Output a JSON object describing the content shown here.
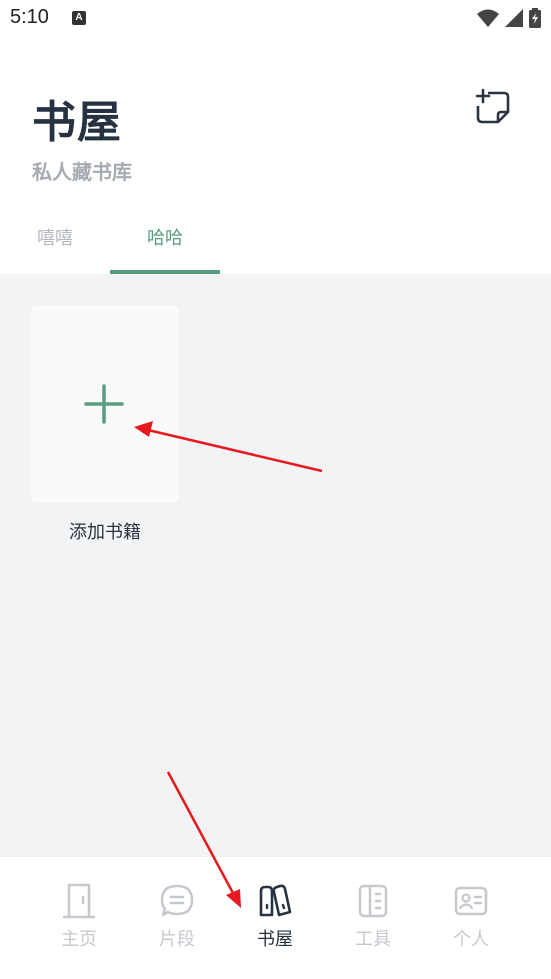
{
  "status_bar": {
    "time": "5:10",
    "notification_letter": "A"
  },
  "header": {
    "title": "书屋",
    "subtitle": "私人藏书库",
    "add_icon": "add-note-icon"
  },
  "tabs": [
    {
      "label": "嘻嘻",
      "active": false
    },
    {
      "label": "哈哈",
      "active": true
    }
  ],
  "shelf": {
    "add_book_label": "添加书籍"
  },
  "bottom_nav": [
    {
      "label": "主页",
      "icon": "door-icon",
      "active": false
    },
    {
      "label": "片段",
      "icon": "chat-bubble-icon",
      "active": false
    },
    {
      "label": "书屋",
      "icon": "books-icon",
      "active": true
    },
    {
      "label": "工具",
      "icon": "ruler-icon",
      "active": false
    },
    {
      "label": "个人",
      "icon": "id-card-icon",
      "active": false
    }
  ],
  "colors": {
    "accent": "#5a9c7f",
    "annotation_arrow": "#e8191e",
    "background": "#f2f3f5"
  }
}
